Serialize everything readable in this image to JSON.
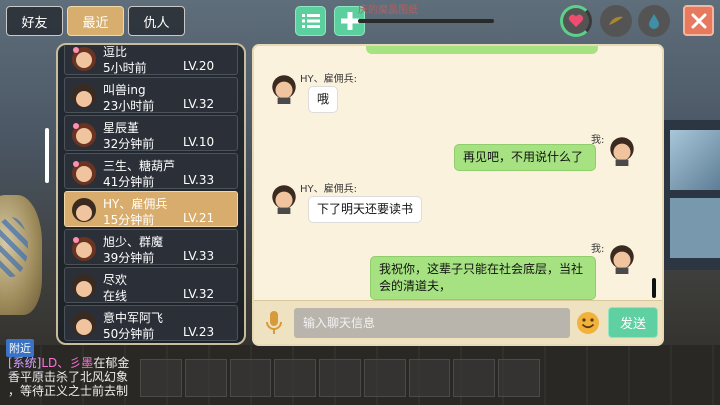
{
  "tabs": [
    {
      "label": "好友",
      "active": false
    },
    {
      "label": "最近",
      "active": true
    },
    {
      "label": "仇人",
      "active": false
    }
  ],
  "quest_text": "庆的魔晶图纸",
  "friends": [
    {
      "name": "逗比",
      "time": "5小时前",
      "level": "LV.20",
      "gender": "female"
    },
    {
      "name": "叫兽ing",
      "time": "23小时前",
      "level": "LV.32",
      "gender": "male"
    },
    {
      "name": "星辰堇",
      "time": "32分钟前",
      "level": "LV.10",
      "gender": "female"
    },
    {
      "name": "三生、糖葫芦",
      "time": "41分钟前",
      "level": "LV.33",
      "gender": "female"
    },
    {
      "name": "HY、雇佣兵",
      "time": "15分钟前",
      "level": "LV.21",
      "gender": "male",
      "selected": true
    },
    {
      "name": "旭少、群魔",
      "time": "39分钟前",
      "level": "LV.33",
      "gender": "female"
    },
    {
      "name": "尽欢",
      "time": "在线",
      "level": "LV.32",
      "gender": "male"
    },
    {
      "name": "意中军阿飞",
      "time": "50分钟前",
      "level": "LV.23",
      "gender": "male"
    }
  ],
  "messages": [
    {
      "sender": "HY、雇佣兵:",
      "text": "哦",
      "incoming": true
    },
    {
      "sender": "我:",
      "text": "再见吧，不用说什么了",
      "incoming": false
    },
    {
      "sender": "HY、雇佣兵:",
      "text": "下了明天还要读书",
      "incoming": true
    },
    {
      "sender": "我:",
      "text": "我祝你，这辈子只能在社会底层，当社会的清道夫，",
      "incoming": false
    }
  ],
  "input": {
    "placeholder": "输入聊天信息",
    "value": ""
  },
  "send_label": "发送",
  "nearby_label": "附近",
  "system_log": {
    "tag": "[系统]",
    "player": "LD、彡墨",
    "line1_suffix": "在郁金",
    "line2": "香平原击杀了北风幻象",
    "line3": "，等待正义之士前去制"
  },
  "colors": {
    "accent_green": "#5bcf9e",
    "tab_active": "#d7ae6d",
    "bubble_out": "#a6e281",
    "close": "#e6795e"
  },
  "icons": {
    "list": "list-icon",
    "add": "plus-icon",
    "health": "heart-icon",
    "hunger": "drumstick-icon",
    "water": "water-drop-icon",
    "close": "close-icon",
    "mic": "microphone-icon",
    "emoji": "smiley-icon"
  }
}
